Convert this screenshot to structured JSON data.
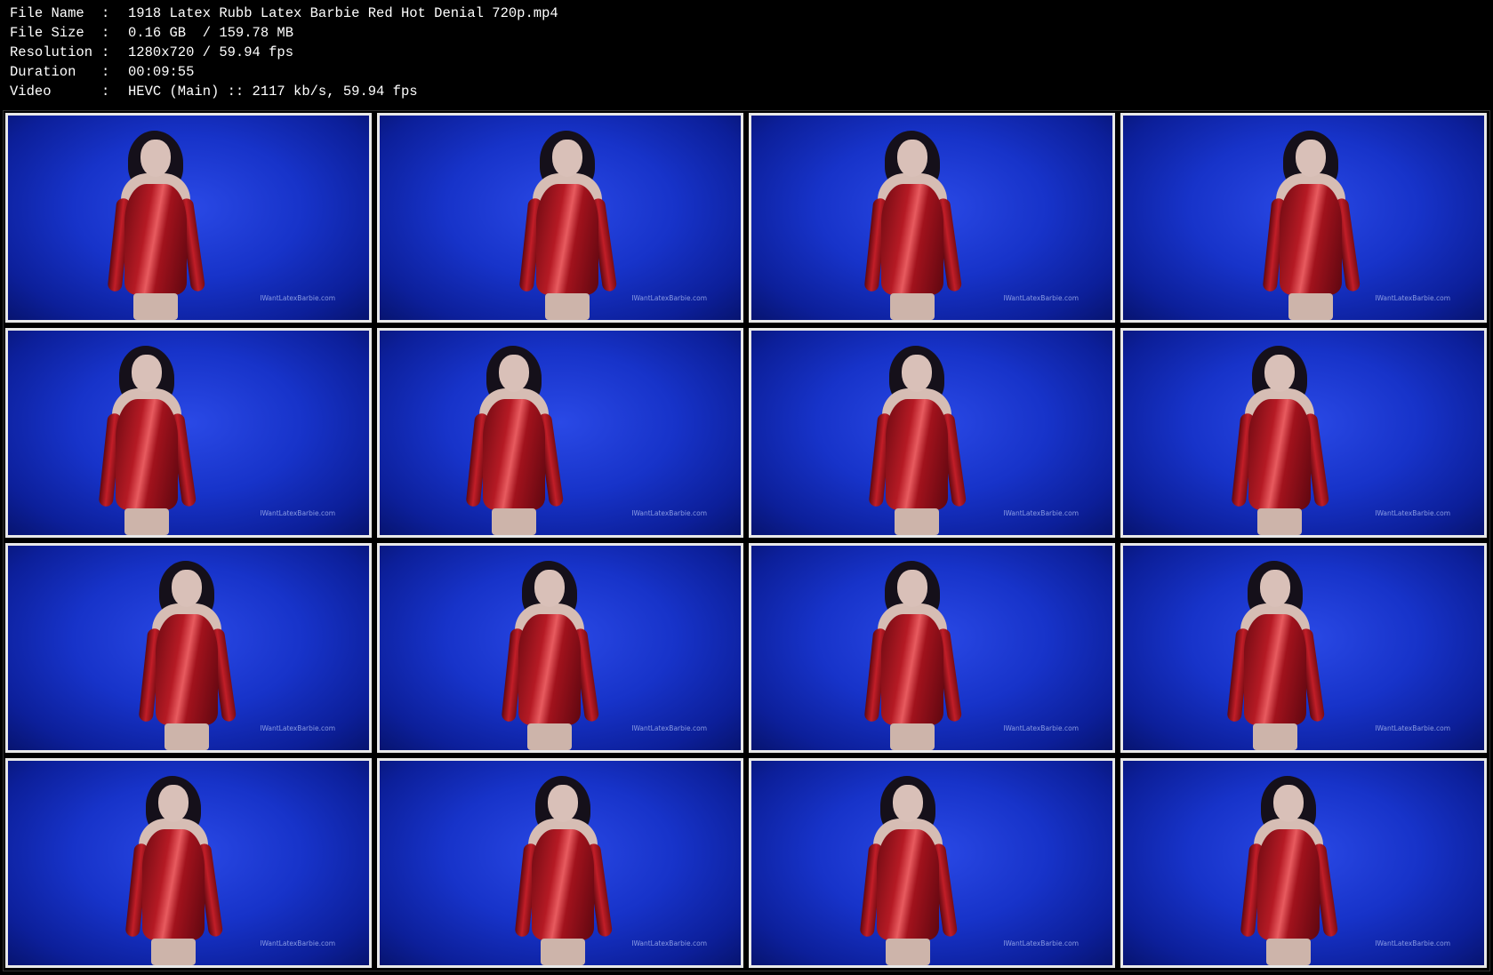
{
  "info": {
    "rows": [
      {
        "label": "File Name",
        "sep": ":",
        "value": "1918 Latex Rubb Latex Barbie Red Hot Denial 720p.mp4"
      },
      {
        "label": "File Size",
        "sep": ":",
        "value": "0.16 GB  / 159.78 MB"
      },
      {
        "label": "Resolution",
        "sep": ":",
        "value": "1280x720 / 59.94 fps"
      },
      {
        "label": "Duration",
        "sep": ":",
        "value": "00:09:55"
      },
      {
        "label": "Video",
        "sep": ":",
        "value": "HEVC (Main) :: 2117 kb/s, 59.94 fps"
      }
    ]
  },
  "thumbnails": {
    "watermark": "IWantLatexBarbie.com",
    "count": 16
  },
  "colors": {
    "background": "#000000",
    "text": "#ffffff",
    "thumb_border": "#e8e8e8",
    "backdrop_blue": "#1733c9",
    "dress_red": "#b51a24"
  }
}
